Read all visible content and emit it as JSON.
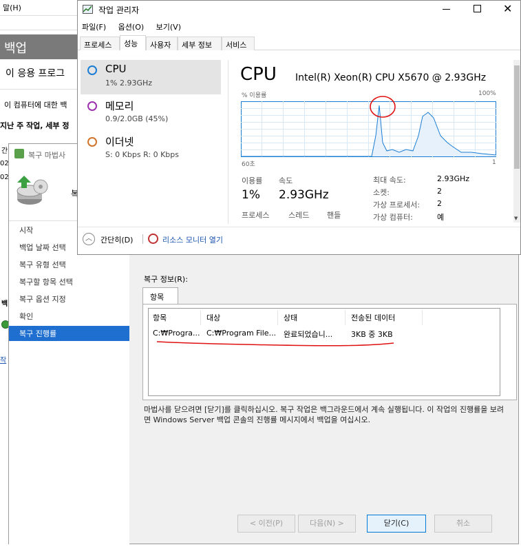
{
  "background": {
    "menu_text": "말(H)",
    "title": "백업",
    "subtitle": "이 응용 프로그",
    "line1": "이 컴퓨터에 대한 백",
    "line2": "지난 주 작업, 세부 정",
    "left_labels": [
      "간",
      "02",
      "02",
      "백",
      "작"
    ]
  },
  "wizard": {
    "title": "복구 마법사",
    "header_partial": "복",
    "nav": [
      "시작",
      "백업 날짜 선택",
      "복구 유형 선택",
      "복구할 항목 선택",
      "복구 옵션 지정",
      "확인",
      "복구 진행률"
    ],
    "group_label": "복구 정보(R):",
    "tab_label": "항목",
    "columns": [
      "항목",
      "대상",
      "상태",
      "전송된 데이터"
    ],
    "rows": [
      {
        "item": "C:₩Progra...",
        "target": "C:₩Program File...",
        "status": "완료되었습니...",
        "data": "3KB 중 3KB"
      }
    ],
    "info": "마법사를 닫으려면 [닫기]를 클릭하십시오. 복구 작업은 백그라운드에서 계속 실행됩니다. 이 작업의 진행률을 보려면 Windows Server 백업 콘솔의 진행률 메시지에서 백업을 여십시오.",
    "buttons": {
      "prev": "< 이전(P)",
      "next": "다음(N) >",
      "close": "닫기(C)",
      "cancel": "취소"
    }
  },
  "taskmanager": {
    "title": "작업 관리자",
    "menu": [
      "파일(F)",
      "옵션(O)",
      "보기(V)"
    ],
    "tabs": [
      "프로세스",
      "성능",
      "사용자",
      "세부 정보",
      "서비스"
    ],
    "active_tab": 1,
    "side": [
      {
        "name": "CPU",
        "sub": "1% 2.93GHz",
        "color": "#1a7dd4"
      },
      {
        "name": "메모리",
        "sub": "0.9/2.0GB (45%)",
        "color": "#9b2fae"
      },
      {
        "name": "이더넷",
        "sub": "S: 0 Kbps R: 0 Kbps",
        "color": "#d1742b"
      }
    ],
    "cpu_title": "CPU",
    "cpu_model": "Intel(R) Xeon(R) CPU X5670 @ 2.93GHz",
    "graph_ylabel": "% 이용률",
    "graph_ymax": "100%",
    "graph_xleft": "60초",
    "graph_xright": "1",
    "usage_label": "이용률",
    "speed_label": "속도",
    "usage_value": "1%",
    "speed_value": "2.93GHz",
    "small_labels": [
      "프로세스",
      "스레드",
      "핸들"
    ],
    "kv": [
      {
        "k": "최대 속도:",
        "v": "2.93GHz"
      },
      {
        "k": "소켓:",
        "v": "2"
      },
      {
        "k": "가상 프로세서:",
        "v": "2"
      },
      {
        "k": "가상 컴퓨터:",
        "v": "예"
      }
    ],
    "fewer_details": "간단히(D)",
    "resource_monitor": "리소스 모니터 열기",
    "graph_color": "#1a7dd4"
  }
}
